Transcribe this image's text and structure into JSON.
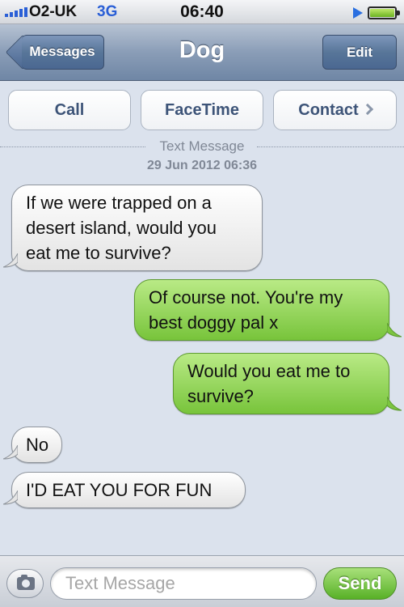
{
  "status_bar": {
    "carrier": "O2-UK",
    "network": "3G",
    "time": "06:40",
    "signal_bars": 5,
    "battery_level": 1.0
  },
  "nav": {
    "back_label": "Messages",
    "title": "Dog",
    "edit_label": "Edit"
  },
  "actions": {
    "call": "Call",
    "facetime": "FaceTime",
    "contact": "Contact"
  },
  "thread": {
    "label": "Text Message",
    "date": "29 Jun 2012 06:36"
  },
  "messages": [
    {
      "sender": "them",
      "lines": [
        "If we were trapped on a",
        "desert island, would you",
        "eat me to survive?"
      ]
    },
    {
      "sender": "me",
      "lines": [
        "Of course not. You're my",
        "best doggy pal x"
      ]
    },
    {
      "sender": "me",
      "lines": [
        "Would you eat me to",
        "survive?"
      ]
    },
    {
      "sender": "them",
      "lines": [
        "No"
      ]
    },
    {
      "sender": "them",
      "lines": [
        "I'D EAT YOU FOR FUN"
      ]
    }
  ],
  "composer": {
    "placeholder": "Text Message",
    "value": "",
    "send_label": "Send"
  },
  "colors": {
    "sent_bubble": "#78c43b",
    "received_bubble": "#ffffff",
    "background": "#dbe2ed",
    "nav_bar": "#6f86a5"
  }
}
